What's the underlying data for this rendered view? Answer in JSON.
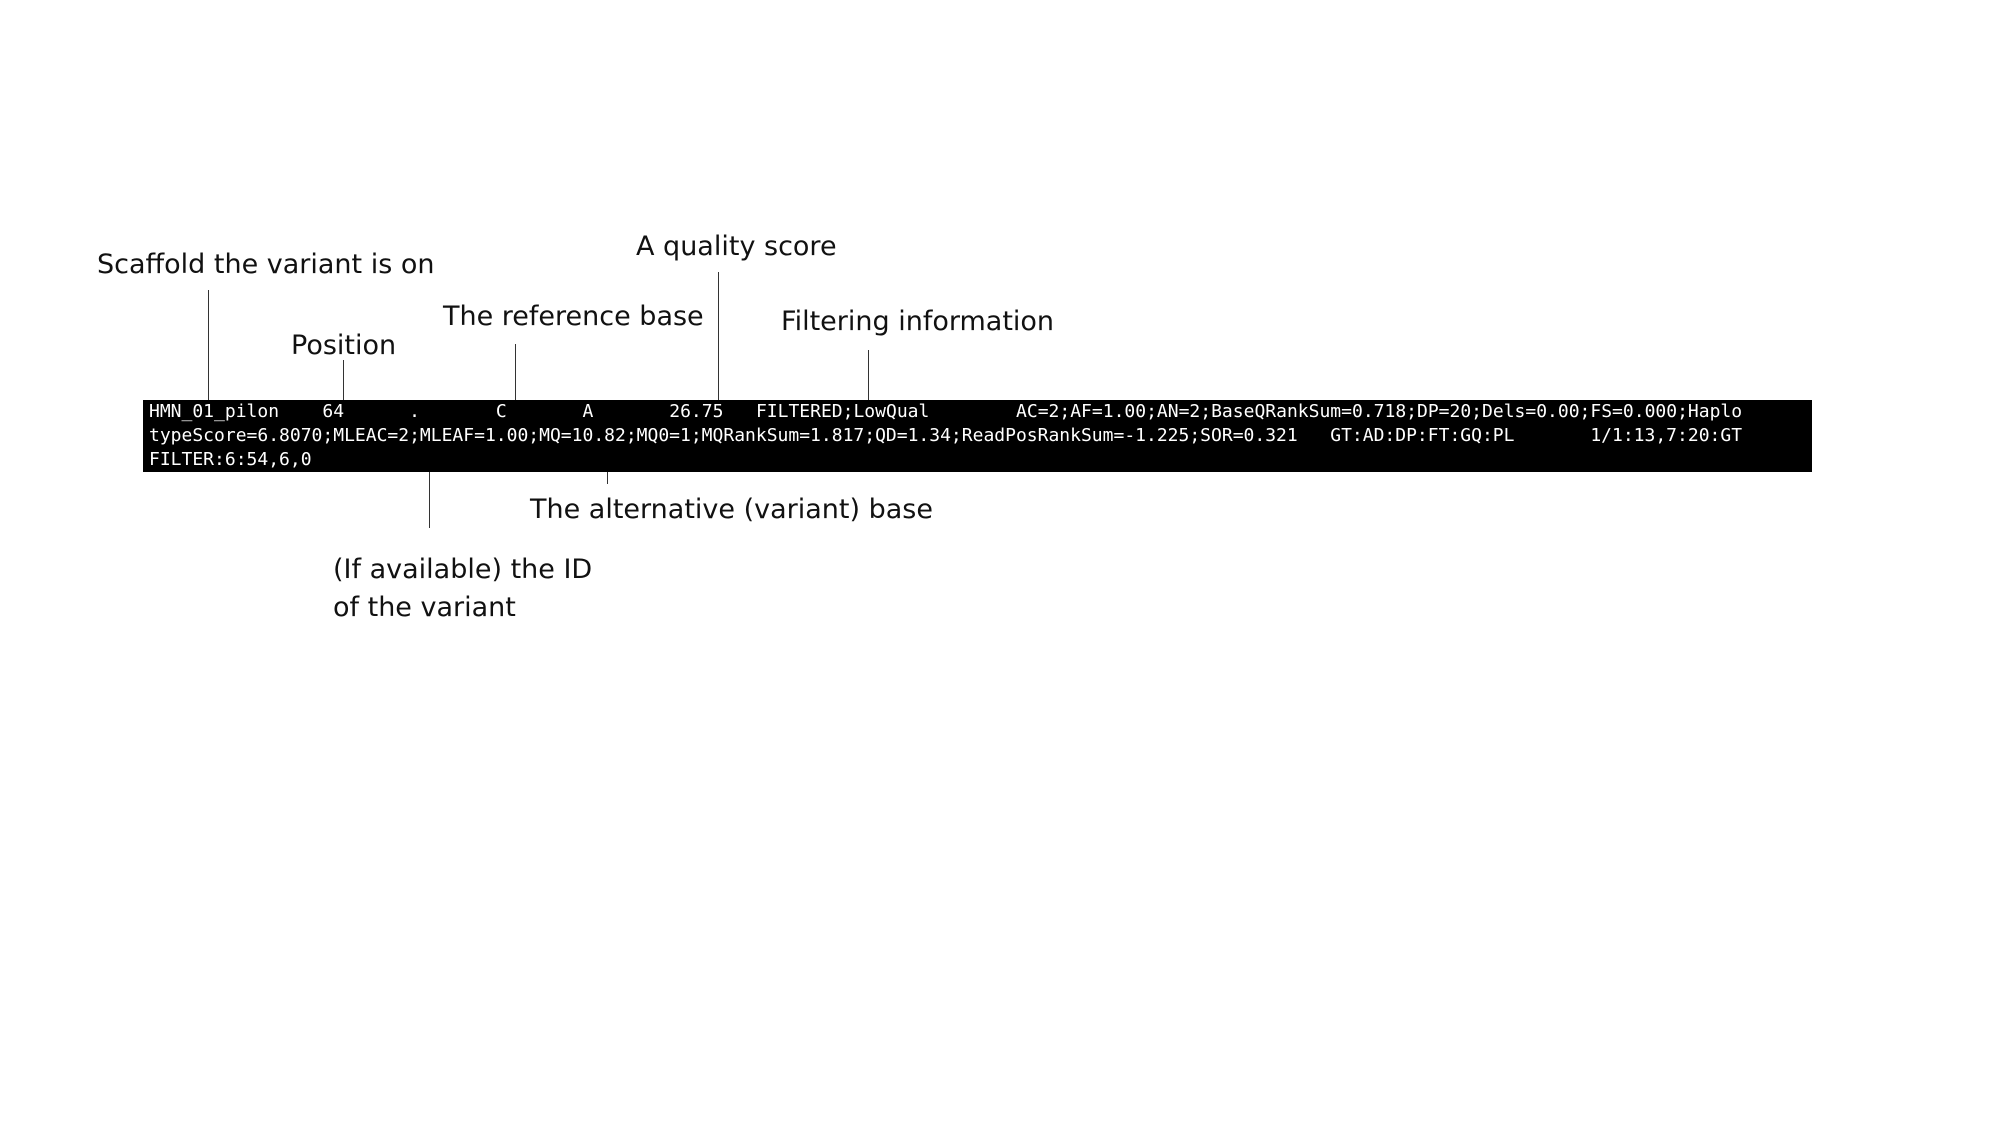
{
  "annotations": {
    "scaffold": "Scaffold the variant is on",
    "position": "Position",
    "reference": "The reference base",
    "quality": "A quality score",
    "filter": "Filtering information",
    "alternative": "The alternative (variant) base",
    "id": [
      "(If available) the ID",
      "of the variant"
    ]
  },
  "vcf_record": {
    "line1": {
      "chrom": "HMN_01_pilon",
      "pos": "64",
      "id": ".",
      "ref": "C",
      "alt": "A",
      "qual": "26.75",
      "filter": "FILTERED;LowQual",
      "info_start": "AC=2;AF=1.00;AN=2;BaseQRankSum=0.718;DP=20;Dels=0.00;FS=0.000;Haplo"
    },
    "line2": {
      "info_end": "typeScore=6.8070;MLEAC=2;MLEAF=1.00;MQ=10.82;MQ0=1;MQRankSum=1.817;QD=1.34;ReadPosRankSum=-1.225;SOR=0.321",
      "format": "GT:AD:DP:FT:GQ:PL",
      "sample_start": "1/1:13,7:20:GT"
    },
    "line3": {
      "sample_end": "FILTER:6:54,6,0"
    }
  },
  "colors": {
    "background": "#ffffff",
    "record_box": "#000000",
    "record_text": "#ffffff",
    "leader_lines": "#333333"
  }
}
